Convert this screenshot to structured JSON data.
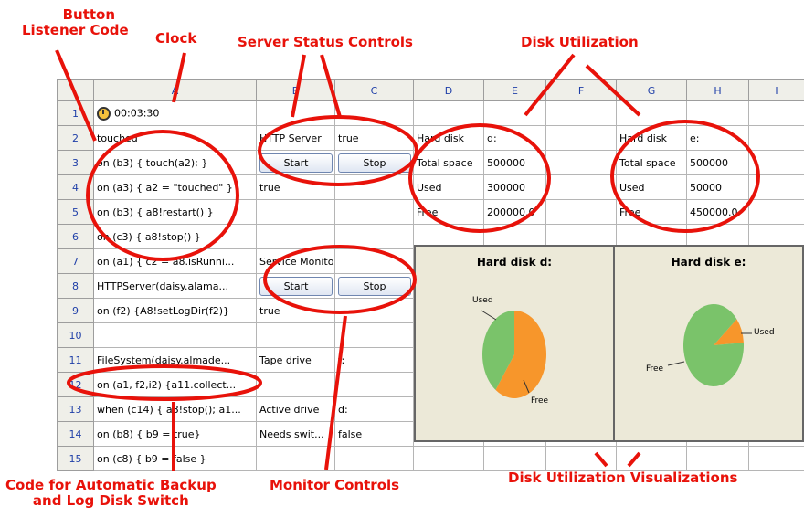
{
  "annotations": {
    "button_listener_line1": "Button",
    "button_listener_line2": "Listener Code",
    "clock": "Clock",
    "server_status": "Server Status Controls",
    "disk_utilization": "Disk Utilization",
    "code_backup_line1": "Code for Automatic Backup",
    "code_backup_line2": "and Log Disk Switch",
    "monitor_controls": "Monitor Controls",
    "disk_viz": "Disk Utilization Visualizations"
  },
  "columns": [
    "A",
    "B",
    "C",
    "D",
    "E",
    "F",
    "G",
    "H",
    "I"
  ],
  "rows": {
    "r1": {
      "num": "1",
      "a": "00:03:30"
    },
    "r2": {
      "num": "2",
      "a": "touched",
      "b": "HTTP Server",
      "c": "true",
      "d": "Hard disk",
      "e": "d:",
      "g": "Hard disk",
      "h": "e:"
    },
    "r3": {
      "num": "3",
      "a": "on (b3) { touch(a2); }",
      "b_btn": "Start",
      "c_btn": "Stop",
      "d": "Total space",
      "e": "500000",
      "g": "Total space",
      "h": "500000"
    },
    "r4": {
      "num": "4",
      "a": "on (a3) { a2 = \"touched\" }",
      "b": "true",
      "d": "Used",
      "e": "300000",
      "g": "Used",
      "h": "50000"
    },
    "r5": {
      "num": "5",
      "a": "on (b3) { a8!restart() }",
      "d": "Free",
      "e": "200000.0",
      "g": "Free",
      "h": "450000.0"
    },
    "r6": {
      "num": "6",
      "a": "on (c3) { a8!stop() }"
    },
    "r7": {
      "num": "7",
      "a": "on (a1) { c2 = a8.isRunni...",
      "b": "Service Monitor"
    },
    "r8": {
      "num": "8",
      "a": "HTTPServer(daisy.alama...",
      "b_btn": "Start",
      "c_btn": "Stop"
    },
    "r9": {
      "num": "9",
      "a": "on (f2) {A8!setLogDir(f2)}",
      "b": "true"
    },
    "r10": {
      "num": "10"
    },
    "r11": {
      "num": "11",
      "a": "FileSystem(daisy.almade...",
      "b": "Tape drive",
      "c": "f:"
    },
    "r12": {
      "num": "12",
      "a": "on (a1, f2,i2) {a11.collect..."
    },
    "r13": {
      "num": "13",
      "a": "when (c14) { a8!stop(); a1...",
      "b": "Active drive",
      "c": "d:"
    },
    "r14": {
      "num": "14",
      "a": "on (b8) { b9 = true}",
      "b": "Needs swit...",
      "c": "false"
    },
    "r15": {
      "num": "15",
      "a": "on (c8) { b9 = false }"
    }
  },
  "charts": {
    "disk_d_title": "Hard disk d:",
    "disk_e_title": "Hard disk e:",
    "used_label": "Used",
    "free_label": "Free",
    "used_color": "#f7962b",
    "free_color": "#7ac36a"
  },
  "chart_data": [
    {
      "type": "pie",
      "title": "Hard disk d:",
      "labels": [
        "Used",
        "Free"
      ],
      "values": [
        300000,
        200000
      ]
    },
    {
      "type": "pie",
      "title": "Hard disk e:",
      "labels": [
        "Used",
        "Free"
      ],
      "values": [
        50000,
        450000
      ]
    }
  ]
}
